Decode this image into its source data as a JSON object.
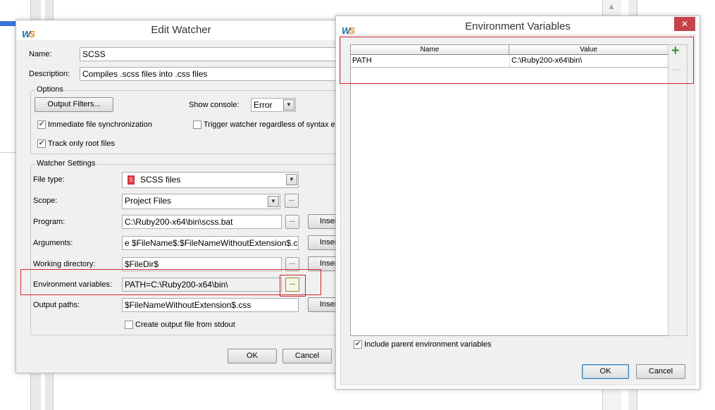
{
  "background": {
    "selection_color": "#3874d8"
  },
  "edit_watcher": {
    "title": "Edit Watcher",
    "name_label": "Name:",
    "name_value": "SCSS",
    "description_label": "Description:",
    "description_value": "Compiles .scss files into .css files",
    "options": {
      "title": "Options",
      "output_filters": "Output Filters...",
      "show_console_label": "Show console:",
      "show_console_value": "Error",
      "immediate_sync": {
        "label": "Immediate file synchronization",
        "checked": true
      },
      "trigger_regardless": {
        "label": "Trigger watcher regardless of syntax e",
        "checked": false
      },
      "track_root": {
        "label": "Track only root files",
        "checked": true
      }
    },
    "settings": {
      "title": "Watcher Settings",
      "file_type_label": "File type:",
      "file_type_value": "SCSS files",
      "scope_label": "Scope:",
      "scope_value": "Project Files",
      "program_label": "Program:",
      "program_value": "C:\\Ruby200-x64\\bin\\scss.bat",
      "arguments_label": "Arguments:",
      "arguments_value": "e $FileName$:$FileNameWithoutExtension$.css",
      "working_dir_label": "Working directory:",
      "working_dir_value": "$FileDir$",
      "env_label": "Environment variables:",
      "env_value": "PATH=C:\\Ruby200-x64\\bin\\",
      "output_label": "Output paths:",
      "output_value": "$FileNameWithoutExtension$.css",
      "create_stdout": {
        "label": "Create output file from stdout",
        "checked": false
      },
      "insert_label": "Inser",
      "dots": "..."
    },
    "ok": "OK",
    "cancel": "Cancel"
  },
  "env_dialog": {
    "title": "Environment Variables",
    "close": "✕",
    "columns": [
      "Name",
      "Value"
    ],
    "rows": [
      {
        "name": "PATH",
        "value": "C:\\Ruby200-x64\\bin\\"
      }
    ],
    "add": "+",
    "remove": "—",
    "include_parent": {
      "label": "Include parent environment variables",
      "checked": true
    },
    "ok": "OK",
    "cancel": "Cancel"
  },
  "accent": {
    "highlight": "#d0282e",
    "close_bg": "#c7434a",
    "add_green": "#3a9a3a"
  }
}
